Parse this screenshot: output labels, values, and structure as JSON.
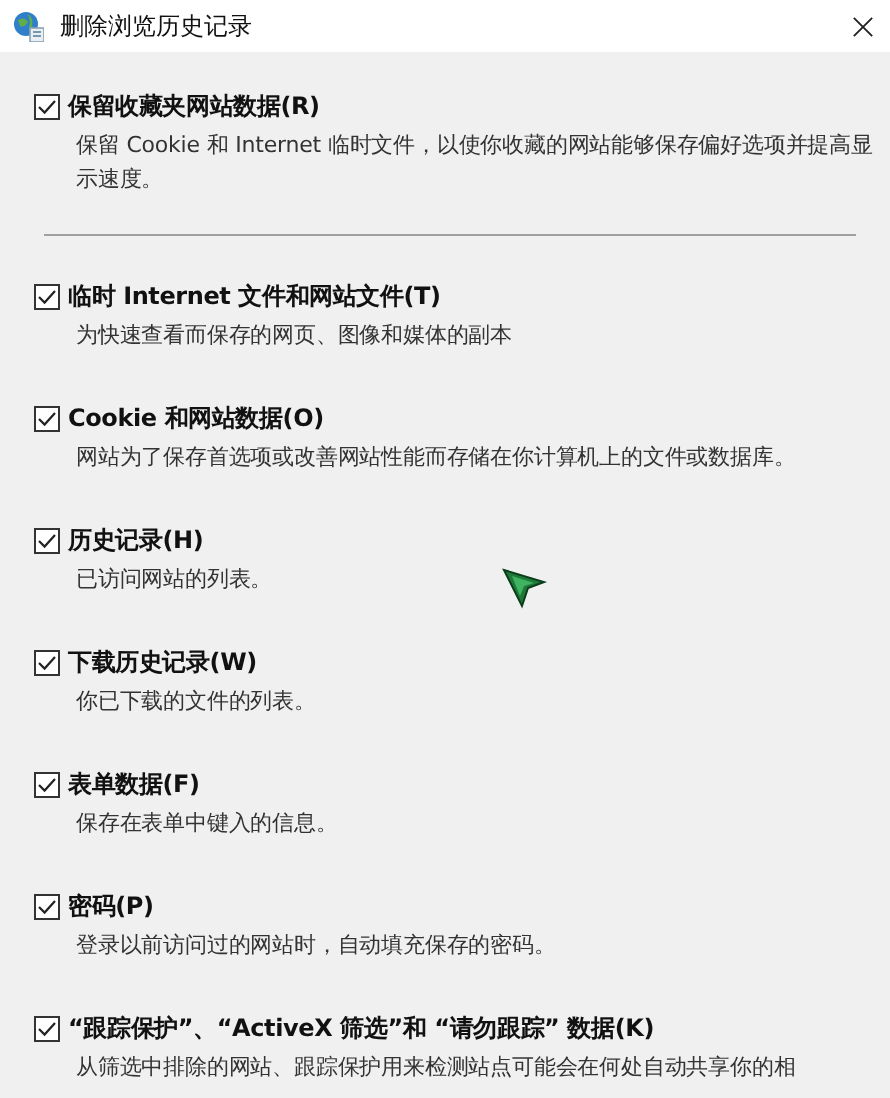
{
  "window": {
    "title": "删除浏览历史记录"
  },
  "preserve_option": {
    "label": "保留收藏夹网站数据(R)",
    "description": "保留 Cookie 和 Internet 临时文件，以使你收藏的网站能够保存偏好选项并提高显示速度。",
    "checked": true
  },
  "options": [
    {
      "label": "临时 Internet 文件和网站文件(T)",
      "description": "为快速查看而保存的网页、图像和媒体的副本",
      "checked": true
    },
    {
      "label": "Cookie 和网站数据(O)",
      "description": "网站为了保存首选项或改善网站性能而存储在你计算机上的文件或数据库。",
      "checked": true
    },
    {
      "label": "历史记录(H)",
      "description": "已访问网站的列表。",
      "checked": true
    },
    {
      "label": "下载历史记录(W)",
      "description": "你已下载的文件的列表。",
      "checked": true
    },
    {
      "label": "表单数据(F)",
      "description": "保存在表单中键入的信息。",
      "checked": true
    },
    {
      "label": "密码(P)",
      "description": "登录以前访问过的网站时，自动填充保存的密码。",
      "checked": true
    },
    {
      "label": "“跟踪保护”、“ActiveX 筛选”和 “请勿跟踪” 数据(K)",
      "description": "从筛选中排除的网站、跟踪保护用来检测站点可能会在何处自动共享你的相",
      "checked": true
    }
  ]
}
